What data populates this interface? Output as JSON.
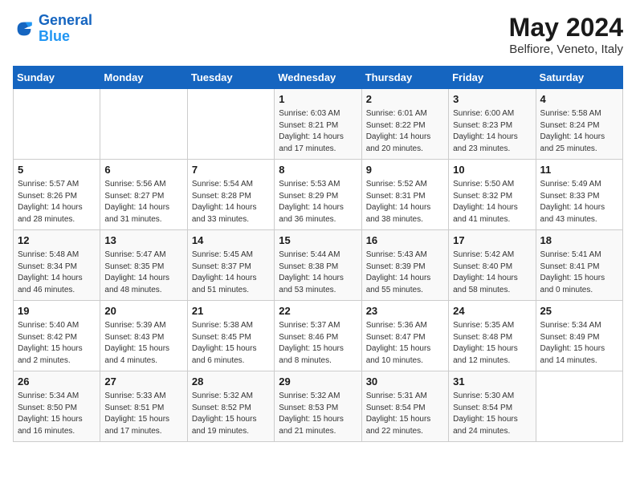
{
  "header": {
    "logo_line1": "General",
    "logo_line2": "Blue",
    "month": "May 2024",
    "location": "Belfiore, Veneto, Italy"
  },
  "columns": [
    "Sunday",
    "Monday",
    "Tuesday",
    "Wednesday",
    "Thursday",
    "Friday",
    "Saturday"
  ],
  "weeks": [
    [
      {
        "day": "",
        "info": ""
      },
      {
        "day": "",
        "info": ""
      },
      {
        "day": "",
        "info": ""
      },
      {
        "day": "1",
        "info": "Sunrise: 6:03 AM\nSunset: 8:21 PM\nDaylight: 14 hours\nand 17 minutes."
      },
      {
        "day": "2",
        "info": "Sunrise: 6:01 AM\nSunset: 8:22 PM\nDaylight: 14 hours\nand 20 minutes."
      },
      {
        "day": "3",
        "info": "Sunrise: 6:00 AM\nSunset: 8:23 PM\nDaylight: 14 hours\nand 23 minutes."
      },
      {
        "day": "4",
        "info": "Sunrise: 5:58 AM\nSunset: 8:24 PM\nDaylight: 14 hours\nand 25 minutes."
      }
    ],
    [
      {
        "day": "5",
        "info": "Sunrise: 5:57 AM\nSunset: 8:26 PM\nDaylight: 14 hours\nand 28 minutes."
      },
      {
        "day": "6",
        "info": "Sunrise: 5:56 AM\nSunset: 8:27 PM\nDaylight: 14 hours\nand 31 minutes."
      },
      {
        "day": "7",
        "info": "Sunrise: 5:54 AM\nSunset: 8:28 PM\nDaylight: 14 hours\nand 33 minutes."
      },
      {
        "day": "8",
        "info": "Sunrise: 5:53 AM\nSunset: 8:29 PM\nDaylight: 14 hours\nand 36 minutes."
      },
      {
        "day": "9",
        "info": "Sunrise: 5:52 AM\nSunset: 8:31 PM\nDaylight: 14 hours\nand 38 minutes."
      },
      {
        "day": "10",
        "info": "Sunrise: 5:50 AM\nSunset: 8:32 PM\nDaylight: 14 hours\nand 41 minutes."
      },
      {
        "day": "11",
        "info": "Sunrise: 5:49 AM\nSunset: 8:33 PM\nDaylight: 14 hours\nand 43 minutes."
      }
    ],
    [
      {
        "day": "12",
        "info": "Sunrise: 5:48 AM\nSunset: 8:34 PM\nDaylight: 14 hours\nand 46 minutes."
      },
      {
        "day": "13",
        "info": "Sunrise: 5:47 AM\nSunset: 8:35 PM\nDaylight: 14 hours\nand 48 minutes."
      },
      {
        "day": "14",
        "info": "Sunrise: 5:45 AM\nSunset: 8:37 PM\nDaylight: 14 hours\nand 51 minutes."
      },
      {
        "day": "15",
        "info": "Sunrise: 5:44 AM\nSunset: 8:38 PM\nDaylight: 14 hours\nand 53 minutes."
      },
      {
        "day": "16",
        "info": "Sunrise: 5:43 AM\nSunset: 8:39 PM\nDaylight: 14 hours\nand 55 minutes."
      },
      {
        "day": "17",
        "info": "Sunrise: 5:42 AM\nSunset: 8:40 PM\nDaylight: 14 hours\nand 58 minutes."
      },
      {
        "day": "18",
        "info": "Sunrise: 5:41 AM\nSunset: 8:41 PM\nDaylight: 15 hours\nand 0 minutes."
      }
    ],
    [
      {
        "day": "19",
        "info": "Sunrise: 5:40 AM\nSunset: 8:42 PM\nDaylight: 15 hours\nand 2 minutes."
      },
      {
        "day": "20",
        "info": "Sunrise: 5:39 AM\nSunset: 8:43 PM\nDaylight: 15 hours\nand 4 minutes."
      },
      {
        "day": "21",
        "info": "Sunrise: 5:38 AM\nSunset: 8:45 PM\nDaylight: 15 hours\nand 6 minutes."
      },
      {
        "day": "22",
        "info": "Sunrise: 5:37 AM\nSunset: 8:46 PM\nDaylight: 15 hours\nand 8 minutes."
      },
      {
        "day": "23",
        "info": "Sunrise: 5:36 AM\nSunset: 8:47 PM\nDaylight: 15 hours\nand 10 minutes."
      },
      {
        "day": "24",
        "info": "Sunrise: 5:35 AM\nSunset: 8:48 PM\nDaylight: 15 hours\nand 12 minutes."
      },
      {
        "day": "25",
        "info": "Sunrise: 5:34 AM\nSunset: 8:49 PM\nDaylight: 15 hours\nand 14 minutes."
      }
    ],
    [
      {
        "day": "26",
        "info": "Sunrise: 5:34 AM\nSunset: 8:50 PM\nDaylight: 15 hours\nand 16 minutes."
      },
      {
        "day": "27",
        "info": "Sunrise: 5:33 AM\nSunset: 8:51 PM\nDaylight: 15 hours\nand 17 minutes."
      },
      {
        "day": "28",
        "info": "Sunrise: 5:32 AM\nSunset: 8:52 PM\nDaylight: 15 hours\nand 19 minutes."
      },
      {
        "day": "29",
        "info": "Sunrise: 5:32 AM\nSunset: 8:53 PM\nDaylight: 15 hours\nand 21 minutes."
      },
      {
        "day": "30",
        "info": "Sunrise: 5:31 AM\nSunset: 8:54 PM\nDaylight: 15 hours\nand 22 minutes."
      },
      {
        "day": "31",
        "info": "Sunrise: 5:30 AM\nSunset: 8:54 PM\nDaylight: 15 hours\nand 24 minutes."
      },
      {
        "day": "",
        "info": ""
      }
    ]
  ]
}
